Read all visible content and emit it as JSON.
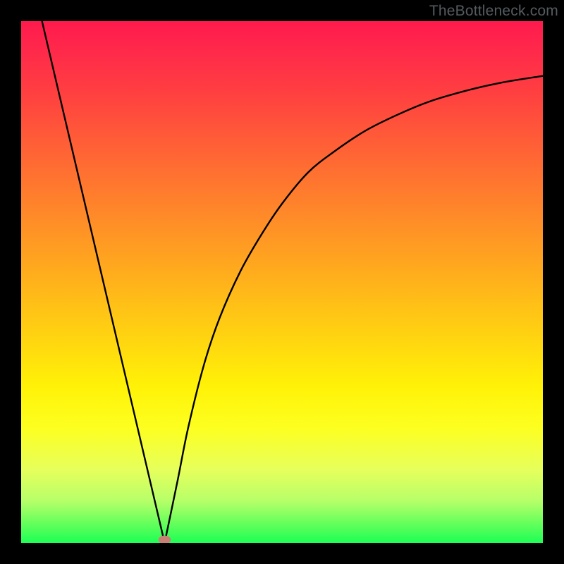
{
  "watermark": "TheBottleneck.com",
  "chart_data": {
    "type": "line",
    "title": "",
    "xlabel": "",
    "ylabel": "",
    "xlim": [
      0,
      100
    ],
    "ylim": [
      0,
      100
    ],
    "series": [
      {
        "name": "left-linear-branch",
        "x": [
          4,
          27.5
        ],
        "values": [
          100,
          0
        ]
      },
      {
        "name": "right-curve-branch",
        "x": [
          27.5,
          30,
          32,
          35,
          38,
          42,
          46,
          50,
          55,
          60,
          66,
          72,
          78,
          85,
          92,
          100
        ],
        "values": [
          0,
          12,
          22,
          34,
          43,
          52,
          59,
          65,
          71,
          75,
          79,
          82,
          84.5,
          86.6,
          88.2,
          89.5
        ]
      }
    ],
    "annotations": [
      {
        "type": "marker",
        "shape": "ellipse",
        "x": 27.5,
        "y": 0.6,
        "rx": 1.2,
        "ry": 0.8,
        "color": "#c88075"
      }
    ],
    "colors": {
      "curve": "#000000",
      "marker": "#c88075",
      "gradient_top": "#ff1a4d",
      "gradient_bottom": "#1dff56",
      "frame": "#000000"
    }
  }
}
